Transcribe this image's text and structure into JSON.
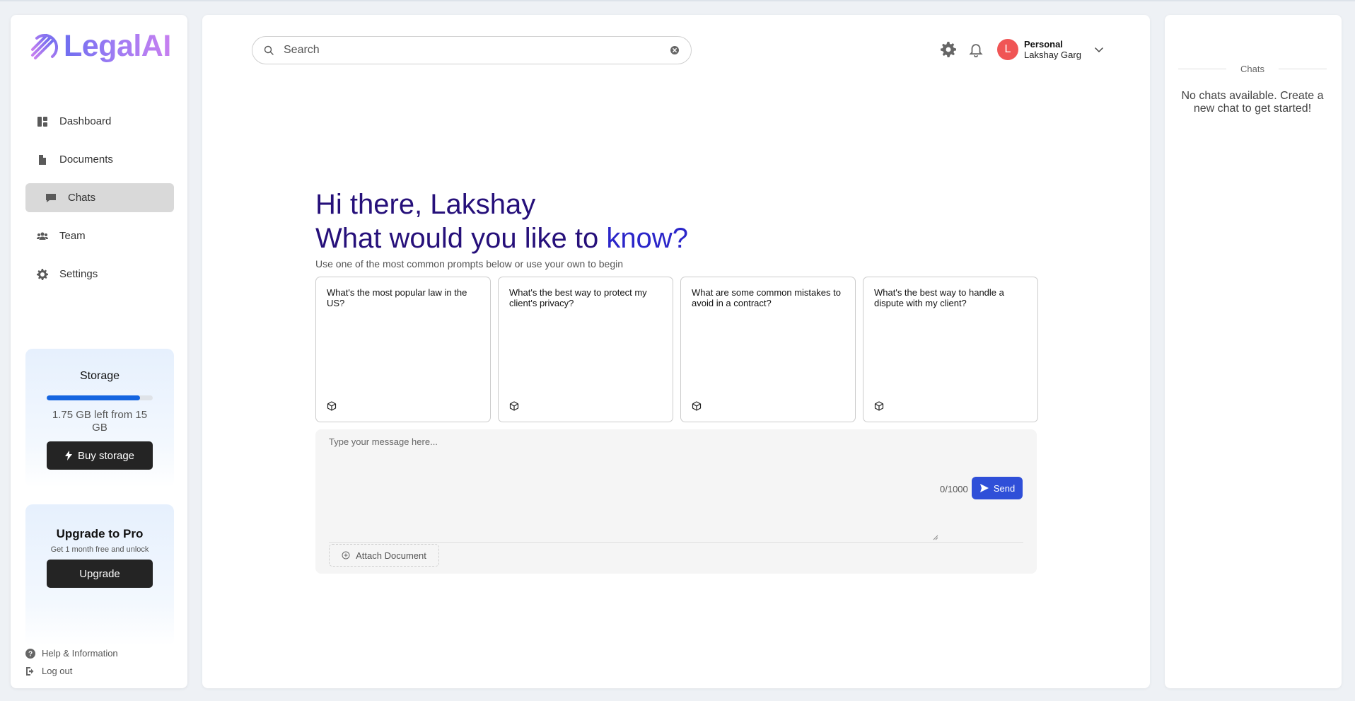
{
  "app": {
    "name": "LegalAI"
  },
  "sidebar": {
    "items": [
      {
        "label": "Dashboard",
        "icon": "dashboard-icon"
      },
      {
        "label": "Documents",
        "icon": "document-icon"
      },
      {
        "label": "Chats",
        "icon": "chat-icon",
        "active": true
      },
      {
        "label": "Team",
        "icon": "team-icon"
      },
      {
        "label": "Settings",
        "icon": "gear-icon"
      }
    ],
    "storage": {
      "title": "Storage",
      "used_fraction": 0.883,
      "text": "1.75 GB left from 15 GB",
      "button": "Buy storage"
    },
    "pro": {
      "title": "Upgrade to Pro",
      "subtitle": "Get 1 month free and unlock",
      "button": "Upgrade"
    },
    "footer": [
      {
        "label": "Help & Information",
        "icon": "help-icon"
      },
      {
        "label": "Log out",
        "icon": "logout-icon"
      }
    ]
  },
  "header": {
    "search": {
      "placeholder": "Search",
      "value": ""
    },
    "user": {
      "initial": "L",
      "type": "Personal",
      "name": "Lakshay Garg"
    }
  },
  "main": {
    "greeting_line1": "Hi there, Lakshay",
    "greeting_line2_prefix": "What would you like to ",
    "greeting_line2_highlight": "know?",
    "subtitle": "Use one of the most common prompts below or use your own to begin",
    "prompts": [
      "What's the most popular law in the US?",
      "What's the best way to protect my client's privacy?",
      "What are some common mistakes to avoid in a contract?",
      "What's the best way to handle a dispute with my client?"
    ],
    "composer": {
      "placeholder": "Type your message here...",
      "char_count": "0/1000",
      "send": "Send",
      "attach": "Attach Document"
    }
  },
  "right_panel": {
    "title": "Chats",
    "empty": "No chats available. Create a new chat to get started!"
  },
  "colors": {
    "accent": "#2f4fd8",
    "brand_gradient_start": "#6f6ef0",
    "brand_gradient_end": "#c77ff0",
    "greeting": "#26107a",
    "greeting_highlight": "#2b26c9",
    "avatar": "#f05555",
    "storage_bar": "#1565e0"
  }
}
